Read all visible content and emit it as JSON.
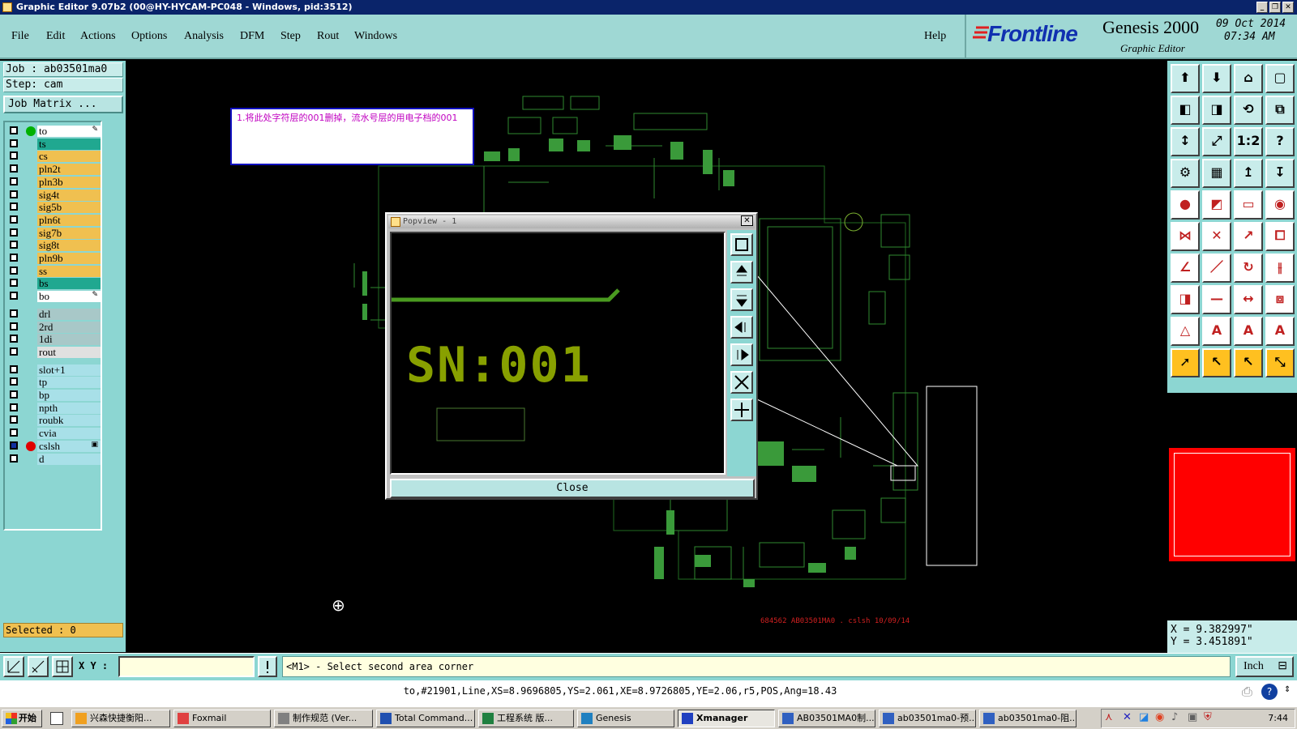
{
  "window": {
    "title": "Graphic Editor 9.07b2 (00@HY-HYCAM-PC048 - Windows, pid:3512)"
  },
  "menu": {
    "items": [
      "File",
      "Edit",
      "Actions",
      "Options",
      "Analysis",
      "DFM",
      "Step",
      "Rout",
      "Windows"
    ],
    "help": "Help"
  },
  "brand": {
    "logo": "Frontline",
    "product": "Genesis 2000",
    "subtitle": "Graphic Editor",
    "date": "09 Oct 2014",
    "time": "07:34 AM"
  },
  "left": {
    "job_line": "Job : ab03501ma0",
    "step_line": "Step: cam",
    "job_matrix": "Job Matrix ...",
    "selected": "Selected : 0",
    "layers": [
      {
        "name": "to",
        "color": "#ffffff",
        "dot": "#00b000",
        "mark": "✎"
      },
      {
        "name": "ts",
        "color": "#20a890"
      },
      {
        "name": "cs",
        "color": "#f0c050"
      },
      {
        "name": "pln2t",
        "color": "#f0c050"
      },
      {
        "name": "pln3b",
        "color": "#f0c050"
      },
      {
        "name": "sig4t",
        "color": "#f0c050"
      },
      {
        "name": "sig5b",
        "color": "#f0c050"
      },
      {
        "name": "pln6t",
        "color": "#f0c050"
      },
      {
        "name": "sig7b",
        "color": "#f0c050"
      },
      {
        "name": "sig8t",
        "color": "#f0c050"
      },
      {
        "name": "pln9b",
        "color": "#f0c050"
      },
      {
        "name": "ss",
        "color": "#f0c050"
      },
      {
        "name": "bs",
        "color": "#20a890"
      },
      {
        "name": "bo",
        "color": "#ffffff",
        "mark": "✎"
      },
      {
        "name": "drl",
        "color": "#a8c8c8"
      },
      {
        "name": "2rd",
        "color": "#a8c8c8"
      },
      {
        "name": "1di",
        "color": "#a8c8c8"
      },
      {
        "name": "rout",
        "color": "#e0e0e0"
      },
      {
        "name": "slot+1",
        "color": "#a8e0e8"
      },
      {
        "name": "tp",
        "color": "#a8e0e8"
      },
      {
        "name": "bp",
        "color": "#a8e0e8"
      },
      {
        "name": "npth",
        "color": "#a8e0e8"
      },
      {
        "name": "roubk",
        "color": "#a8e0e8"
      },
      {
        "name": "cvia",
        "color": "#a8e0e8"
      },
      {
        "name": "cslsh",
        "color": "#a8e0e8",
        "dot": "#e00000",
        "mark": "▣",
        "active": true
      },
      {
        "name": "d",
        "color": "#a8e0e8"
      }
    ]
  },
  "canvas": {
    "note": "1.将此处字符层的001删掉，流水号层的用电子档的001",
    "board_label": "684562 AB03501MA0 . cslsh 10/09/14"
  },
  "popview": {
    "title": "Popview - 1",
    "sn_text": "SN:001",
    "close_label": "Close"
  },
  "right": {
    "x_readout": "X = 9.382997\"",
    "y_readout": "Y = 3.451891\""
  },
  "command": {
    "xy_label": "X Y :",
    "xy_value": "",
    "prompt": "<M1> - Select second area corner",
    "unit": "Inch"
  },
  "status": {
    "text": "to,#21901,Line,XS=8.9696805,YS=2.061,XE=8.9726805,YE=2.06,r5,POS,Ang=18.43"
  },
  "taskbar": {
    "start": "开始",
    "tasks": [
      {
        "label": "兴森快捷衡阳..."
      },
      {
        "label": "Foxmail"
      },
      {
        "label": "制作规范 (Ver..."
      },
      {
        "label": "Total Command..."
      },
      {
        "label": "工程系统 版..."
      },
      {
        "label": "Genesis"
      },
      {
        "label": "Xmanager",
        "active": true
      },
      {
        "label": "AB03501MA0制..."
      },
      {
        "label": "ab03501ma0-预..."
      },
      {
        "label": "ab03501ma0-阻..."
      }
    ],
    "clock": "7:44"
  }
}
